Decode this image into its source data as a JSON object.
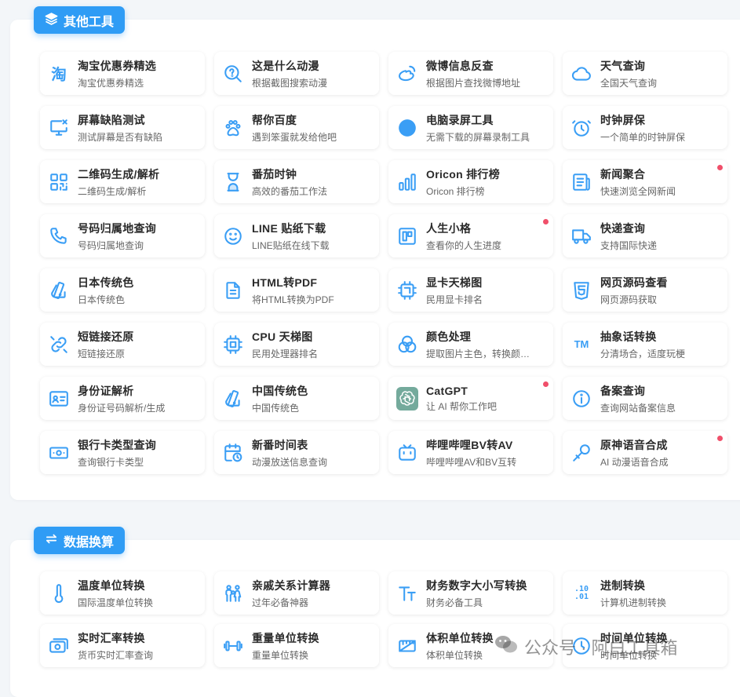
{
  "sections": [
    {
      "title": "其他工具",
      "icon": "layers-icon",
      "cards": [
        {
          "name": "淘宝优惠券精选",
          "desc": "淘宝优惠券精选",
          "icon": "taobao-icon"
        },
        {
          "name": "这是什么动漫",
          "desc": "根据截图搜索动漫",
          "icon": "search-question-icon"
        },
        {
          "name": "微博信息反查",
          "desc": "根据图片查找微博地址",
          "icon": "weibo-icon"
        },
        {
          "name": "天气查询",
          "desc": "全国天气查询",
          "icon": "cloud-icon"
        },
        {
          "name": "屏幕缺陷测试",
          "desc": "测试屏幕是否有缺陷",
          "icon": "monitor-x-icon"
        },
        {
          "name": "帮你百度",
          "desc": "遇到笨蛋就发给他吧",
          "icon": "paw-icon"
        },
        {
          "name": "电脑录屏工具",
          "desc": "无需下载的屏幕录制工具",
          "icon": "record-dot-icon"
        },
        {
          "name": "时钟屏保",
          "desc": "一个简单的时钟屏保",
          "icon": "alarm-clock-icon"
        },
        {
          "name": "二维码生成/解析",
          "desc": "二维码生成/解析",
          "icon": "qrcode-icon"
        },
        {
          "name": "番茄时钟",
          "desc": "高效的番茄工作法",
          "icon": "hourglass-icon"
        },
        {
          "name": "Oricon 排行榜",
          "desc": "Oricon 排行榜",
          "icon": "bar-chart-icon"
        },
        {
          "name": "新闻聚合",
          "desc": "快速浏览全网新闻",
          "icon": "newspaper-icon",
          "dot": true
        },
        {
          "name": "号码归属地查询",
          "desc": "号码归属地查询",
          "icon": "phone-icon"
        },
        {
          "name": "LINE 贴纸下载",
          "desc": "LINE贴纸在线下载",
          "icon": "smile-icon"
        },
        {
          "name": "人生小格",
          "desc": "查看你的人生进度",
          "icon": "grid-layout-icon",
          "dot": true
        },
        {
          "name": "快递查询",
          "desc": "支持国际快递",
          "icon": "truck-icon"
        },
        {
          "name": "日本传统色",
          "desc": "日本传统色",
          "icon": "palette-icon"
        },
        {
          "name": "HTML转PDF",
          "desc": "将HTML转换为PDF",
          "icon": "file-text-icon"
        },
        {
          "name": "显卡天梯图",
          "desc": "民用显卡排名",
          "icon": "gpu-chip-icon"
        },
        {
          "name": "网页源码查看",
          "desc": "网页源码获取",
          "icon": "html5-icon"
        },
        {
          "name": "短链接还原",
          "desc": "短链接还原",
          "icon": "link-icon"
        },
        {
          "name": "CPU 天梯图",
          "desc": "民用处理器排名",
          "icon": "cpu-icon"
        },
        {
          "name": "颜色处理",
          "desc": "提取图片主色，转换颜…",
          "icon": "color-circles-icon"
        },
        {
          "name": "抽象话转换",
          "desc": "分清场合，适度玩梗",
          "icon": "trademark-icon",
          "glyph": "TM"
        },
        {
          "name": "身份证解析",
          "desc": "身份证号码解析/生成",
          "icon": "id-card-icon"
        },
        {
          "name": "中国传统色",
          "desc": "中国传统色",
          "icon": "palette-icon"
        },
        {
          "name": "CatGPT",
          "desc": "让 AI 帮你工作吧",
          "icon": "openai-icon",
          "dot": true
        },
        {
          "name": "备案查询",
          "desc": "查询网站备案信息",
          "icon": "info-icon"
        },
        {
          "name": "银行卡类型查询",
          "desc": "查询银行卡类型",
          "icon": "banknote-icon"
        },
        {
          "name": "新番时间表",
          "desc": "动漫放送信息查询",
          "icon": "calendar-clock-icon"
        },
        {
          "name": "哔哩哔哩BV转AV",
          "desc": "哔哩哔哩AV和BV互转",
          "icon": "bilibili-icon"
        },
        {
          "name": "原神语音合成",
          "desc": "AI 动漫语音合成",
          "icon": "microphone-icon",
          "dot": true
        }
      ]
    },
    {
      "title": "数据换算",
      "icon": "swap-icon",
      "cards": [
        {
          "name": "温度单位转换",
          "desc": "国际温度单位转换",
          "icon": "thermometer-icon"
        },
        {
          "name": "亲戚关系计算器",
          "desc": "过年必备神器",
          "icon": "family-icon"
        },
        {
          "name": "财务数字大小写转换",
          "desc": "财务必备工具",
          "icon": "text-size-icon"
        },
        {
          "name": "进制转换",
          "desc": "计算机进制转换",
          "icon": "binary-icon",
          "glyph": ".10\n.01"
        },
        {
          "name": "实时汇率转换",
          "desc": "货币实时汇率查询",
          "icon": "currency-icon"
        },
        {
          "name": "重量单位转换",
          "desc": "重量单位转换",
          "icon": "dumbbell-icon"
        },
        {
          "name": "体积单位转换",
          "desc": "体积单位转换",
          "icon": "ruler-box-icon"
        },
        {
          "name": "时间单位转换",
          "desc": "时间单位转换",
          "icon": "clock-icon"
        }
      ]
    }
  ],
  "watermark": "公众号 · 阿白工具箱",
  "colors": {
    "accent": "#2f9cf5",
    "icon": "#3a9ef5",
    "dot": "#f04f6a",
    "openai_bg": "#74aa9c"
  }
}
